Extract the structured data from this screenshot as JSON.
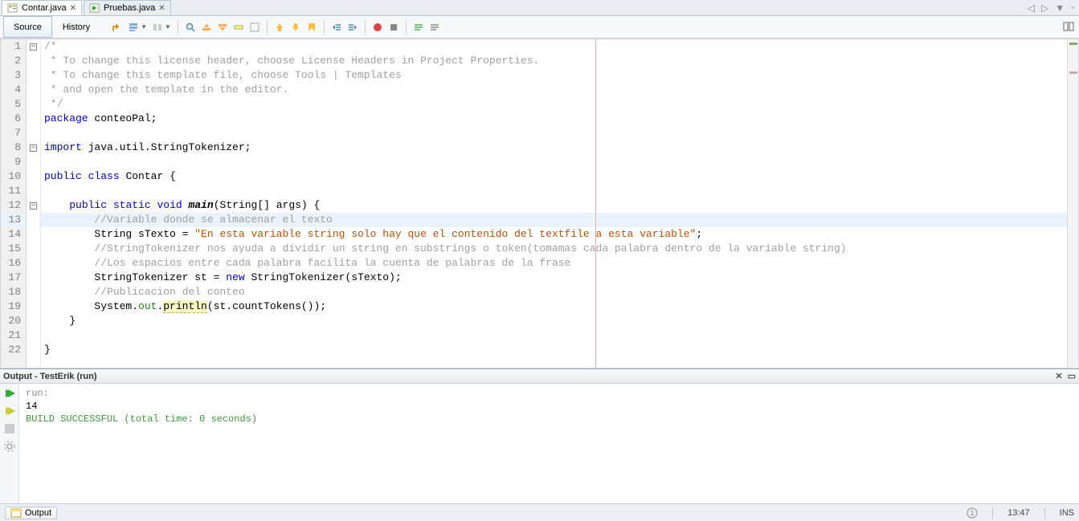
{
  "tabs": [
    {
      "label": "Contar.java",
      "icon": "java-class-icon"
    },
    {
      "label": "Pruebas.java",
      "icon": "java-start-icon"
    }
  ],
  "view": {
    "source": "Source",
    "history": "History"
  },
  "code": {
    "lines": [
      1,
      2,
      3,
      4,
      5,
      6,
      7,
      8,
      9,
      10,
      11,
      12,
      13,
      14,
      15,
      16,
      17,
      18,
      19,
      20,
      21,
      22
    ],
    "l1": "/*",
    "l2": " * To change this license header, choose License Headers in Project Properties.",
    "l3": " * To change this template file, choose Tools | Templates",
    "l4": " * and open the template in the editor.",
    "l5": " */",
    "l6_kw": "package",
    "l6_rest": " conteoPal;",
    "l8_kw": "import",
    "l8_rest": " java.util.StringTokenizer;",
    "l10_kw1": "public",
    "l10_kw2": "class",
    "l10_name": "Contar",
    "l10_brace": " {",
    "l12_pre": "    ",
    "l12_kw1": "public",
    "l12_kw2": "static",
    "l12_kw3": "void",
    "l12_main": "main",
    "l12_rest": "(String[] args) {",
    "l13": "        //Variable donde se almacenar el texto",
    "l14_pre": "        String sTexto = ",
    "l14_str": "\"En esta variable string solo hay que el contenido del textfile a esta variable\"",
    "l14_end": ";",
    "l15": "        //StringTokenizer nos ayuda a dividir un string en substrings o token(tomamas cada palabra dentro de la variable string)",
    "l16": "        //Los espacios entre cada palabra facilita la cuenta de palabras de la frase",
    "l17_pre": "        StringTokenizer st = ",
    "l17_kw": "new",
    "l17_rest": " StringTokenizer(sTexto);",
    "l18": "        //Publicacion del conteo",
    "l19_a": "        System.",
    "l19_out": "out",
    "l19_dot": ".",
    "l19_pr": "println",
    "l19_rest": "(st.countTokens());",
    "l20": "    }",
    "l22": "}"
  },
  "output": {
    "title": "Output - TestErik (run)",
    "run": "run:",
    "result": "14",
    "build": "BUILD SUCCESSFUL (total time: 0 seconds)"
  },
  "status": {
    "output_btn": "Output",
    "notif_count": "1",
    "pos": "13:47",
    "mode": "INS"
  }
}
